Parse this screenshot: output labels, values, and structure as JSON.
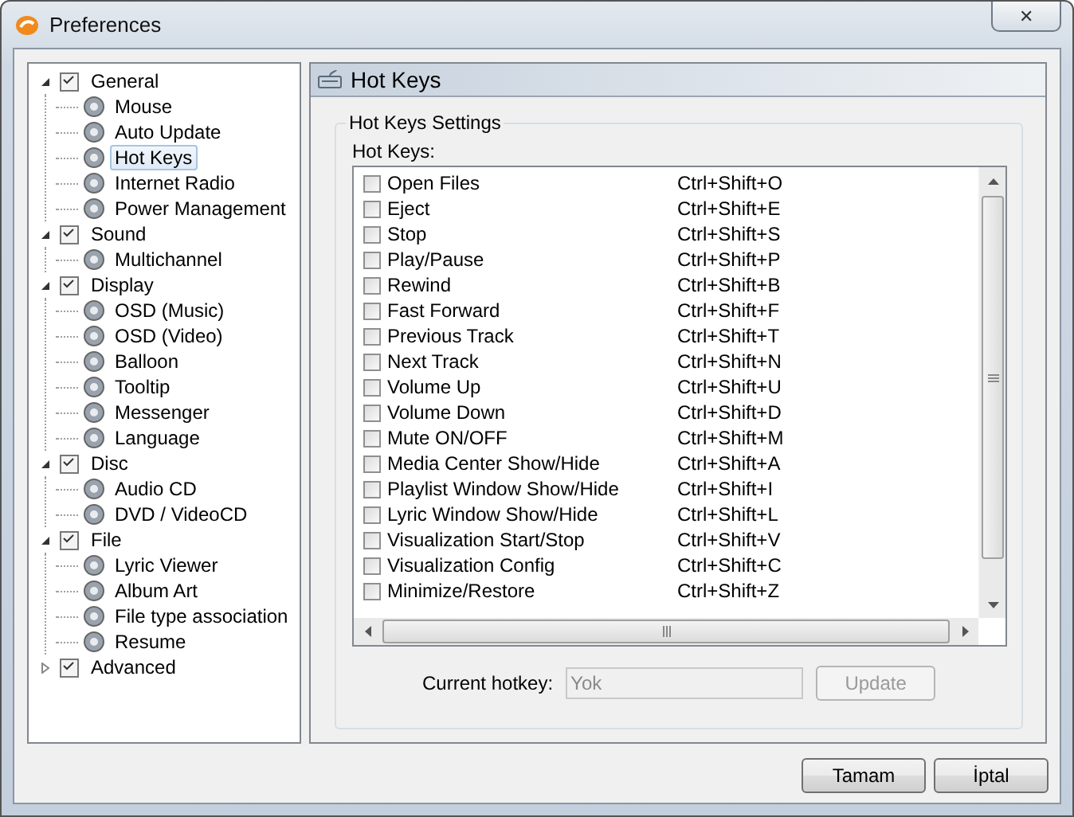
{
  "window": {
    "title": "Preferences",
    "close": "✕"
  },
  "tree": [
    {
      "label": "General",
      "expanded": true,
      "selected": false,
      "children": [
        {
          "label": "Mouse",
          "selected": false
        },
        {
          "label": "Auto Update",
          "selected": false
        },
        {
          "label": "Hot Keys",
          "selected": true
        },
        {
          "label": "Internet Radio",
          "selected": false
        },
        {
          "label": "Power Management",
          "selected": false
        }
      ]
    },
    {
      "label": "Sound",
      "expanded": true,
      "selected": false,
      "children": [
        {
          "label": "Multichannel",
          "selected": false
        }
      ]
    },
    {
      "label": "Display",
      "expanded": true,
      "selected": false,
      "children": [
        {
          "label": "OSD (Music)",
          "selected": false
        },
        {
          "label": "OSD (Video)",
          "selected": false
        },
        {
          "label": "Balloon",
          "selected": false
        },
        {
          "label": "Tooltip",
          "selected": false
        },
        {
          "label": "Messenger",
          "selected": false
        },
        {
          "label": "Language",
          "selected": false
        }
      ]
    },
    {
      "label": "Disc",
      "expanded": true,
      "selected": false,
      "children": [
        {
          "label": "Audio CD",
          "selected": false
        },
        {
          "label": "DVD / VideoCD",
          "selected": false
        }
      ]
    },
    {
      "label": "File",
      "expanded": true,
      "selected": false,
      "children": [
        {
          "label": "Lyric Viewer",
          "selected": false
        },
        {
          "label": "Album Art",
          "selected": false
        },
        {
          "label": "File type association",
          "selected": false
        },
        {
          "label": "Resume",
          "selected": false
        }
      ]
    },
    {
      "label": "Advanced",
      "expanded": false,
      "selected": false
    }
  ],
  "panel": {
    "title": "Hot Keys",
    "group_title": "Hot Keys Settings",
    "list_label": "Hot Keys:",
    "hotkeys": [
      {
        "name": "Open Files",
        "keys": "Ctrl+Shift+O",
        "checked": false
      },
      {
        "name": "Eject",
        "keys": "Ctrl+Shift+E",
        "checked": false
      },
      {
        "name": "Stop",
        "keys": "Ctrl+Shift+S",
        "checked": false
      },
      {
        "name": "Play/Pause",
        "keys": "Ctrl+Shift+P",
        "checked": false
      },
      {
        "name": "Rewind",
        "keys": "Ctrl+Shift+B",
        "checked": false
      },
      {
        "name": "Fast Forward",
        "keys": "Ctrl+Shift+F",
        "checked": false
      },
      {
        "name": "Previous Track",
        "keys": "Ctrl+Shift+T",
        "checked": false
      },
      {
        "name": "Next Track",
        "keys": "Ctrl+Shift+N",
        "checked": false
      },
      {
        "name": "Volume Up",
        "keys": "Ctrl+Shift+U",
        "checked": false
      },
      {
        "name": "Volume Down",
        "keys": "Ctrl+Shift+D",
        "checked": false
      },
      {
        "name": "Mute ON/OFF",
        "keys": "Ctrl+Shift+M",
        "checked": false
      },
      {
        "name": "Media Center Show/Hide",
        "keys": "Ctrl+Shift+A",
        "checked": false
      },
      {
        "name": "Playlist Window Show/Hide",
        "keys": "Ctrl+Shift+I",
        "checked": false
      },
      {
        "name": "Lyric Window Show/Hide",
        "keys": "Ctrl+Shift+L",
        "checked": false
      },
      {
        "name": "Visualization Start/Stop",
        "keys": "Ctrl+Shift+V",
        "checked": false
      },
      {
        "name": "Visualization Config",
        "keys": "Ctrl+Shift+C",
        "checked": false
      },
      {
        "name": "Minimize/Restore",
        "keys": "Ctrl+Shift+Z",
        "checked": false
      }
    ],
    "current_label": "Current hotkey:",
    "current_value": "Yok",
    "current_disabled": true,
    "update_button": {
      "label": "Update",
      "disabled": true
    }
  },
  "buttons": [
    {
      "label": "Tamam"
    },
    {
      "label": "İptal"
    }
  ]
}
